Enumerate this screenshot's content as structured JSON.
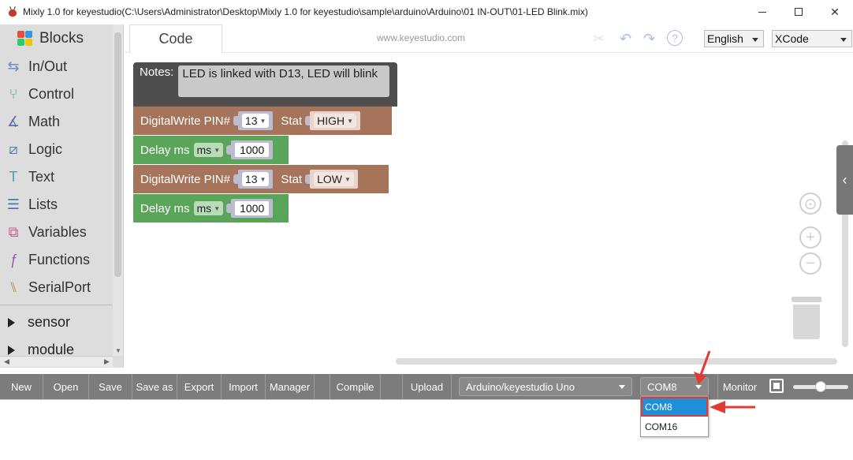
{
  "window": {
    "title": "Mixly 1.0 for keyestudio(C:\\Users\\Administrator\\Desktop\\Mixly 1.0 for keyestudio\\sample\\arduino\\Arduino\\01 IN-OUT\\01-LED Blink.mix)"
  },
  "sidebar": {
    "header": "Blocks",
    "items": [
      {
        "label": "In/Out",
        "icon": "in-out-icon"
      },
      {
        "label": "Control",
        "icon": "control-icon"
      },
      {
        "label": "Math",
        "icon": "math-icon"
      },
      {
        "label": "Logic",
        "icon": "logic-icon"
      },
      {
        "label": "Text",
        "icon": "text-icon"
      },
      {
        "label": "Lists",
        "icon": "lists-icon"
      },
      {
        "label": "Variables",
        "icon": "variables-icon"
      },
      {
        "label": "Functions",
        "icon": "functions-icon"
      },
      {
        "label": "SerialPort",
        "icon": "serialport-icon"
      }
    ],
    "tree": [
      "sensor",
      "module"
    ]
  },
  "tabs": {
    "code": "Code",
    "site": "www.keyestudio.com",
    "language": "English",
    "theme": "XCode"
  },
  "blocks": {
    "notes_label": "Notes:",
    "notes_text": "LED is linked with D13, LED will blink",
    "dw1": {
      "label": "DigitalWrite PIN#",
      "pin": "13",
      "stat_label": "Stat",
      "stat": "HIGH"
    },
    "delay1": {
      "label": "Delay ms",
      "unit": "ms",
      "value": "1000"
    },
    "dw2": {
      "label": "DigitalWrite PIN#",
      "pin": "13",
      "stat_label": "Stat",
      "stat": "LOW"
    },
    "delay2": {
      "label": "Delay ms",
      "unit": "ms",
      "value": "1000"
    }
  },
  "toolbar": {
    "new": "New",
    "open": "Open",
    "save": "Save",
    "save_as": "Save as",
    "export": "Export",
    "import": "Import",
    "manager": "Manager",
    "compile": "Compile",
    "upload": "Upload",
    "board": "Arduino/keyestudio Uno",
    "port": "COM8",
    "monitor": "Monitor"
  },
  "port_dropdown": {
    "options": [
      "COM8",
      "COM16"
    ],
    "selected": "COM8"
  },
  "colors": {
    "notes_block": "#4e4e4e",
    "io_block": "#a5745b",
    "delay_block": "#5ba55b",
    "toolbar": "#7c7c7c",
    "highlight": "#e53935",
    "selection": "#1e90d9"
  }
}
